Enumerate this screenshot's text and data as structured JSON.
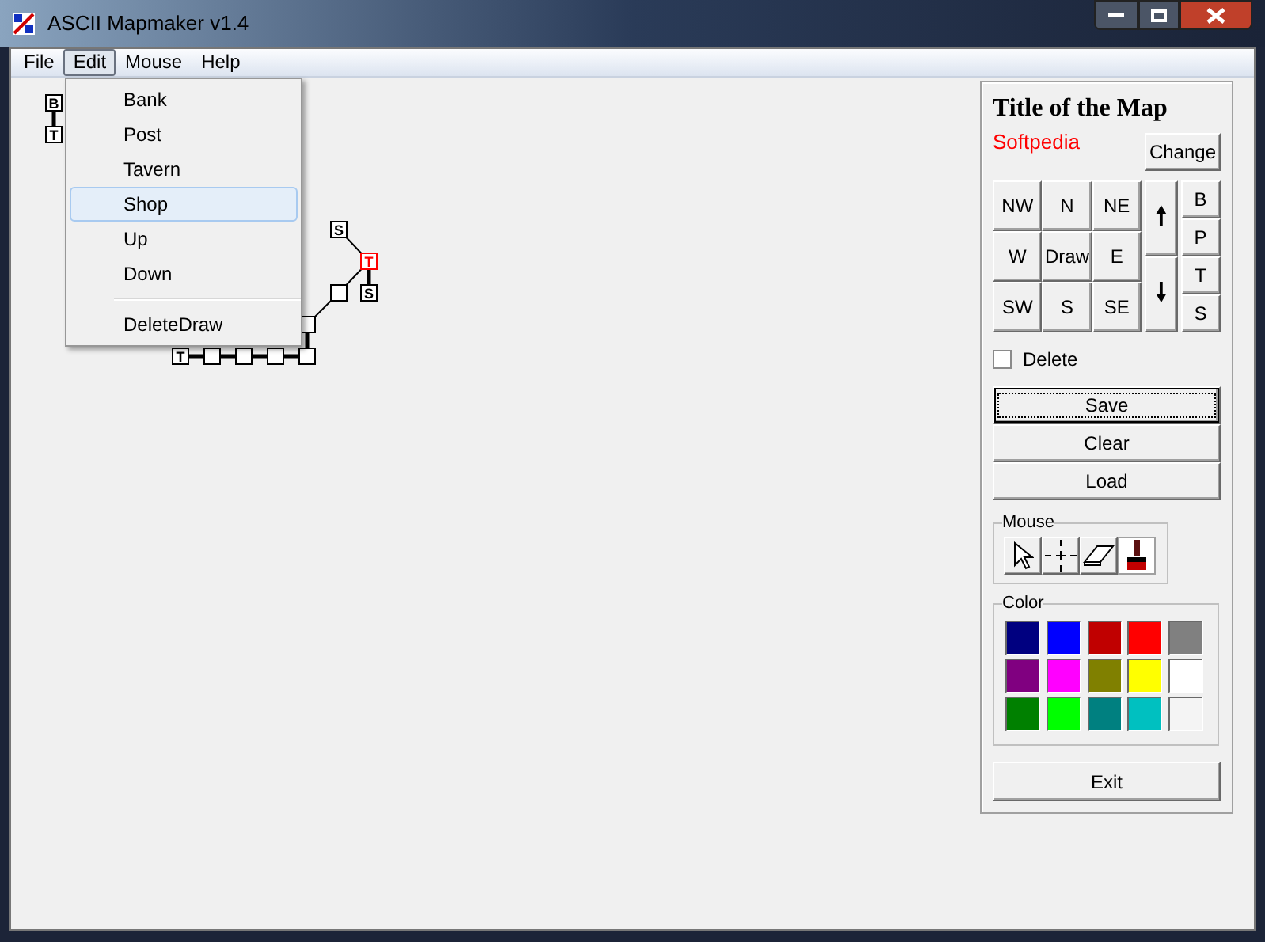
{
  "window": {
    "title": "ASCII Mapmaker v1.4"
  },
  "menu_bar": [
    {
      "label": "File",
      "selected": false
    },
    {
      "label": "Edit",
      "selected": true
    },
    {
      "label": "Mouse",
      "selected": false
    },
    {
      "label": "Help",
      "selected": false
    }
  ],
  "edit_menu": [
    {
      "label": "Bank",
      "selected": false
    },
    {
      "label": "Post",
      "selected": false
    },
    {
      "label": "Tavern",
      "selected": false
    },
    {
      "label": "Shop",
      "selected": true
    },
    {
      "label": "Up",
      "selected": false
    },
    {
      "label": "Down",
      "selected": false
    },
    {
      "kind": "separator"
    },
    {
      "label": "DeleteDraw",
      "selected": false
    }
  ],
  "map_nodes": [
    {
      "label": "B",
      "current": false
    },
    {
      "label": "T",
      "current": false
    },
    {
      "label": "S",
      "current": false
    },
    {
      "label": "T",
      "current": true
    },
    {
      "label": "S",
      "current": false
    },
    {
      "current": false
    },
    {
      "current": false
    },
    {
      "label": "T",
      "current": false
    },
    {
      "current": false
    },
    {
      "current": false
    },
    {
      "current": false
    },
    {
      "current": false
    }
  ],
  "panel": {
    "title": "Title of the Map",
    "map_name": "Softpedia",
    "change_button": "Change",
    "directions": [
      "NW",
      "N",
      "NE",
      "W",
      "Draw",
      "E",
      "SW",
      "S",
      "SE"
    ],
    "up_arrow": "🠕",
    "down_arrow": "🠗",
    "place_buttons": [
      "B",
      "P",
      "T",
      "S"
    ],
    "delete_checkbox": {
      "label": "Delete",
      "checked": false
    },
    "actions": [
      {
        "label": "Save",
        "focused": true
      },
      {
        "label": "Clear",
        "focused": false
      },
      {
        "label": "Load",
        "focused": false
      }
    ],
    "mouse_group": {
      "title": "Mouse",
      "tools": [
        {
          "kind": "pointer",
          "selected": false
        },
        {
          "kind": "crosshair",
          "selected": false
        },
        {
          "kind": "eraser",
          "selected": false
        },
        {
          "kind": "brush",
          "selected": true
        }
      ]
    },
    "color_group": {
      "title": "Color",
      "swatches": [
        {
          "color": "#000080"
        },
        {
          "color": "#0000ff"
        },
        {
          "color": "#c00000"
        },
        {
          "color": "#ff0000"
        },
        {
          "color": "#808080"
        },
        {
          "color": "#800080"
        },
        {
          "color": "#ff00ff"
        },
        {
          "color": "#808000"
        },
        {
          "color": "#ffff00"
        },
        {
          "color": "#ffffff"
        },
        {
          "color": "#008000"
        },
        {
          "color": "#00ff00"
        },
        {
          "color": "#008080"
        },
        {
          "color": "#00c0c0"
        },
        {
          "color": "#f4f4f4"
        }
      ]
    },
    "exit_button": "Exit"
  }
}
